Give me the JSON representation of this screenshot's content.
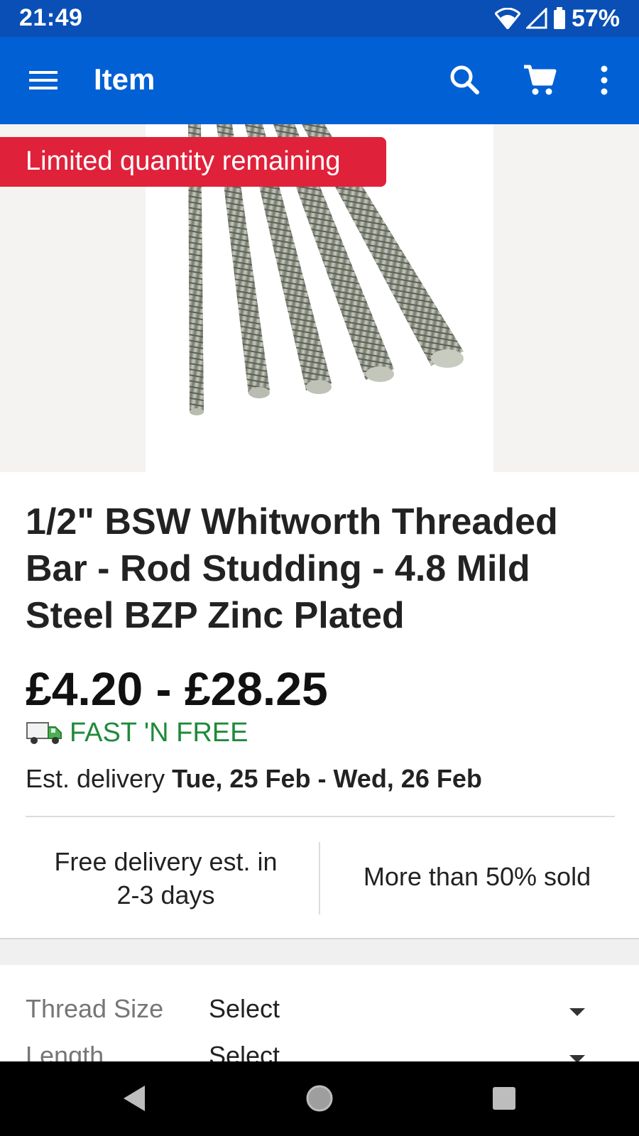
{
  "status_bar": {
    "time": "21:49",
    "battery": "57%"
  },
  "app_bar": {
    "title": "Item",
    "icons": [
      "menu-icon",
      "search-icon",
      "cart-icon",
      "more-vert-icon"
    ]
  },
  "hero": {
    "badge": "Limited quantity remaining"
  },
  "product": {
    "title": "1/2\" BSW Whitworth Threaded Bar - Rod Studding - 4.8 Mild Steel BZP Zinc Plated",
    "price": "£4.20 - £28.25",
    "shipping": "FAST 'N FREE",
    "delivery_prefix": "Est. delivery",
    "delivery_dates": "Tue, 25 Feb - Wed, 26 Feb"
  },
  "facts": {
    "left_line1": "Free delivery est. in",
    "left_line2": "2-3 days",
    "right": "More than 50% sold"
  },
  "options": [
    {
      "label": "Thread Size",
      "value": "Select"
    },
    {
      "label": "Length",
      "value": "Select"
    }
  ],
  "colors": {
    "status_bar": "#0a4fb6",
    "app_bar": "#0060d4",
    "badge": "#e0213a",
    "shipping_text": "#1f8a3a"
  }
}
